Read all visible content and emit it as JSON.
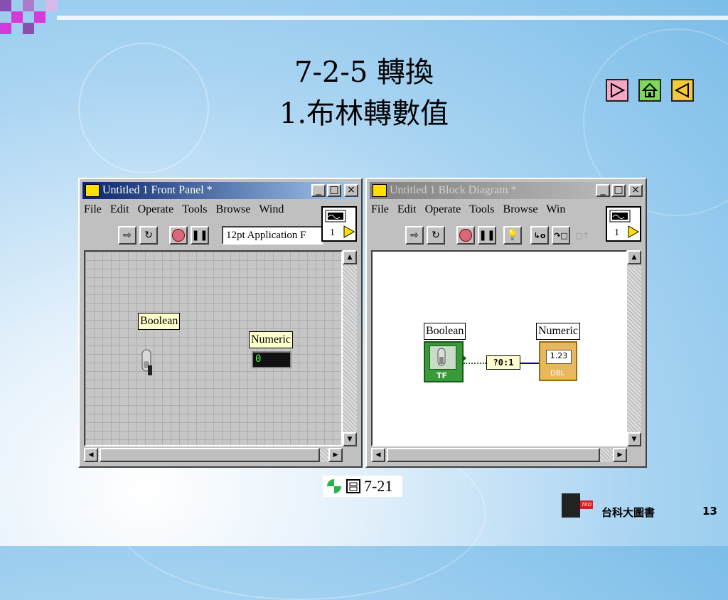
{
  "slide": {
    "title_line1": "7-2-5 轉換",
    "title_line2": "1.布林轉數值",
    "caption_text": "7-21",
    "publisher": "台科大圖書",
    "page_number": "13",
    "logo_text": "TKD"
  },
  "nav": {
    "next_icon": "play-right-icon",
    "home_icon": "home-icon",
    "prev_icon": "play-left-icon"
  },
  "front_panel": {
    "title": "Untitled 1 Front Panel *",
    "menu": [
      "File",
      "Edit",
      "Operate",
      "Tools",
      "Browse",
      "Wind"
    ],
    "font_select": "12pt Application F",
    "run_icon_number": "1",
    "boolean_label": "Boolean",
    "numeric_label": "Numeric",
    "numeric_value": "0"
  },
  "block_diagram": {
    "title": "Untitled 1 Block Diagram *",
    "menu": [
      "File",
      "Edit",
      "Operate",
      "Tools",
      "Browse",
      "Win"
    ],
    "run_icon_number": "1",
    "boolean_label": "Boolean",
    "numeric_label": "Numeric",
    "bool_terminal_type": "TF",
    "num_terminal_value": "1.23",
    "num_terminal_type": "DBL",
    "convert_node": "?0:1"
  },
  "colors": {
    "nav_next": "#f4a6c4",
    "nav_home": "#7ed957",
    "nav_prev": "#f6c93a",
    "deco_purple": "#8a4fb3",
    "deco_magenta": "#d43ad8"
  }
}
